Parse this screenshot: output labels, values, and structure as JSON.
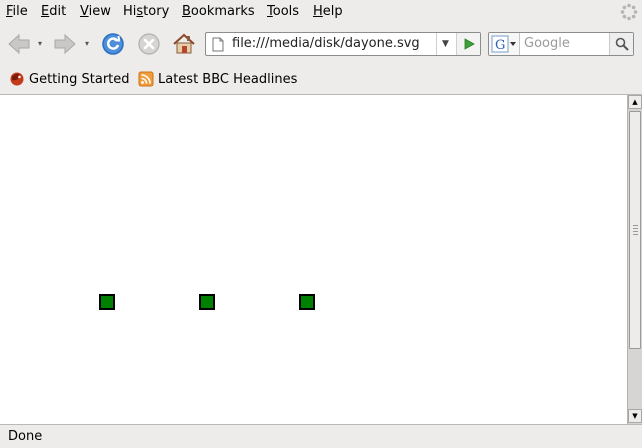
{
  "menu": {
    "items": [
      {
        "prefix": "",
        "mnemonic": "F",
        "rest": "ile"
      },
      {
        "prefix": "",
        "mnemonic": "E",
        "rest": "dit"
      },
      {
        "prefix": "",
        "mnemonic": "V",
        "rest": "iew"
      },
      {
        "prefix": "Hi",
        "mnemonic": "s",
        "rest": "tory"
      },
      {
        "prefix": "",
        "mnemonic": "B",
        "rest": "ookmarks"
      },
      {
        "prefix": "",
        "mnemonic": "T",
        "rest": "ools"
      },
      {
        "prefix": "",
        "mnemonic": "H",
        "rest": "elp"
      }
    ]
  },
  "navigation": {
    "url": "file:///media/disk/dayone.svg",
    "search_placeholder": "Google",
    "search_engine_icon": "google-g-icon"
  },
  "bookmarks": {
    "items": [
      {
        "label": "Getting Started",
        "icon": "firefox-icon"
      },
      {
        "label": "Latest BBC Headlines",
        "icon": "rss-feed-icon"
      }
    ]
  },
  "content": {
    "squares": [
      {
        "color": "#008000"
      },
      {
        "color": "#008000"
      },
      {
        "color": "#008000"
      }
    ]
  },
  "status": {
    "text": "Done"
  },
  "colors": {
    "chrome": "#edeceb",
    "square_fill": "#008000",
    "square_stroke": "#000000",
    "refresh_blue": "#2a6fc0",
    "go_green": "#3aa335"
  }
}
